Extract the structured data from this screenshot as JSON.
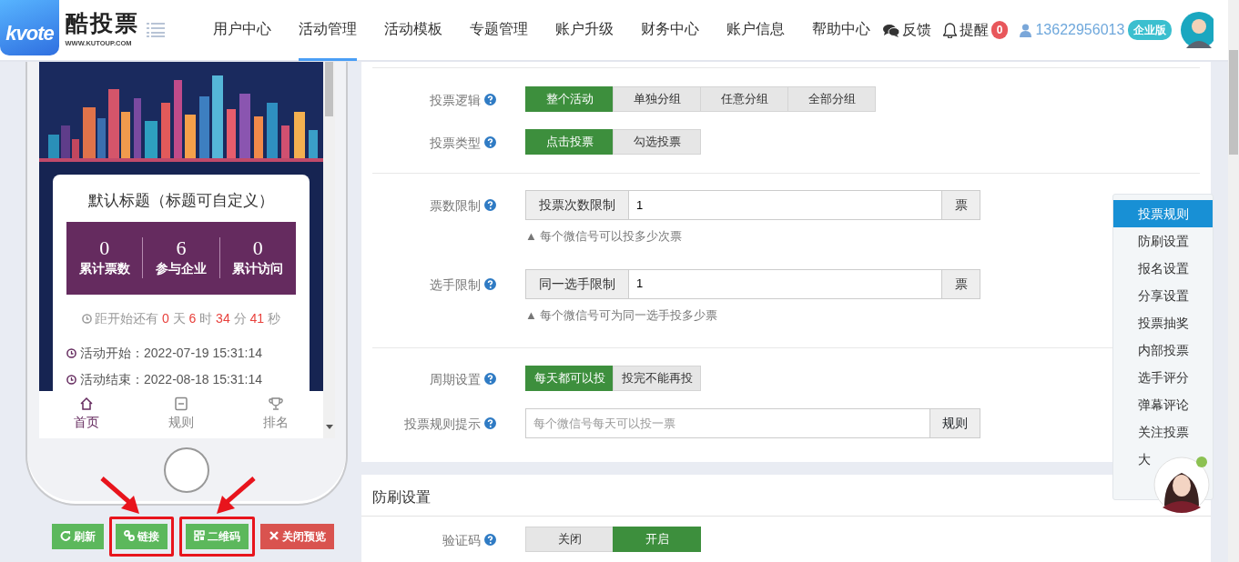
{
  "header": {
    "logo_text": "kvote",
    "brand": "酷投票",
    "domain": "WWW.KUTOUP.COM",
    "nav": [
      {
        "label": "用户中心",
        "selected": false
      },
      {
        "label": "活动管理",
        "selected": true
      },
      {
        "label": "活动模板",
        "selected": false
      },
      {
        "label": "专题管理",
        "selected": false
      },
      {
        "label": "账户升级",
        "selected": false
      },
      {
        "label": "财务中心",
        "selected": false
      },
      {
        "label": "账户信息",
        "selected": false
      },
      {
        "label": "帮助中心",
        "selected": false
      }
    ],
    "feedback": "反馈",
    "reminder": {
      "label": "提醒",
      "count": "0"
    },
    "phone": "13622956013",
    "plan": "企业版"
  },
  "preview": {
    "card_title": "默认标题（标题可自定义）",
    "stats": [
      {
        "value": "0",
        "label": "累计票数"
      },
      {
        "value": "6",
        "label": "参与企业"
      },
      {
        "value": "0",
        "label": "累计访问"
      }
    ],
    "countdown": {
      "prefix": "距开始还有",
      "parts": [
        {
          "value": "0",
          "unit": "天"
        },
        {
          "value": "6",
          "unit": "时"
        },
        {
          "value": "34",
          "unit": "分"
        },
        {
          "value": "41",
          "unit": "秒"
        }
      ]
    },
    "dates": [
      {
        "label": "活动开始：",
        "value": "2022-07-19 15:31:14"
      },
      {
        "label": "活动结束：",
        "value": "2022-08-18 15:31:14"
      }
    ],
    "tabs": [
      {
        "label": "首页",
        "selected": true
      },
      {
        "label": "规则",
        "selected": false
      },
      {
        "label": "排名",
        "selected": false
      }
    ],
    "buttons": [
      {
        "label": "刷新",
        "kind": "success",
        "highlighted": false
      },
      {
        "label": "链接",
        "kind": "success",
        "highlighted": true
      },
      {
        "label": "二维码",
        "kind": "success",
        "highlighted": true
      },
      {
        "label": "关闭预览",
        "kind": "danger",
        "highlighted": false
      }
    ]
  },
  "rules_form": {
    "groups": [
      {
        "rows": [
          {
            "kind": "choice",
            "label": "投票逻辑",
            "options": [
              {
                "label": "整个活动",
                "selected": true
              },
              {
                "label": "单独分组",
                "selected": false
              },
              {
                "label": "任意分组",
                "selected": false
              },
              {
                "label": "全部分组",
                "selected": false
              }
            ]
          },
          {
            "kind": "choice",
            "label": "投票类型",
            "options": [
              {
                "label": "点击投票",
                "selected": true
              },
              {
                "label": "勾选投票",
                "selected": false
              }
            ]
          }
        ]
      },
      {
        "rows": [
          {
            "kind": "limit",
            "label": "票数限制",
            "addon": "投票次数限制",
            "value": "1",
            "unit": "票",
            "hint": "▲ 每个微信号可以投多少次票"
          },
          {
            "kind": "limit",
            "label": "选手限制",
            "addon": "同一选手限制",
            "value": "1",
            "unit": "票",
            "hint": "▲ 每个微信号可为同一选手投多少票"
          }
        ]
      },
      {
        "rows": [
          {
            "kind": "choice",
            "label": "周期设置",
            "options": [
              {
                "label": "每天都可以投",
                "selected": true
              },
              {
                "label": "投完不能再投",
                "selected": false
              }
            ]
          },
          {
            "kind": "text",
            "label": "投票规则提示",
            "placeholder": "每个微信号每天可以投一票",
            "button": "规则"
          }
        ]
      }
    ]
  },
  "anti_spam": {
    "title": "防刷设置",
    "rows": [
      {
        "kind": "choice",
        "label": "验证码",
        "options": [
          {
            "label": "关闭",
            "selected": false
          },
          {
            "label": "开启",
            "selected": true
          }
        ]
      }
    ]
  },
  "side_menu": [
    {
      "label": "投票规则",
      "selected": true
    },
    {
      "label": "防刷设置",
      "selected": false
    },
    {
      "label": "报名设置",
      "selected": false
    },
    {
      "label": "分享设置",
      "selected": false
    },
    {
      "label": "投票抽奖",
      "selected": false
    },
    {
      "label": "内部投票",
      "selected": false
    },
    {
      "label": "选手评分",
      "selected": false
    },
    {
      "label": "弹幕评论",
      "selected": false
    },
    {
      "label": "关注投票",
      "selected": false
    },
    {
      "label": "大",
      "selected": false
    }
  ]
}
